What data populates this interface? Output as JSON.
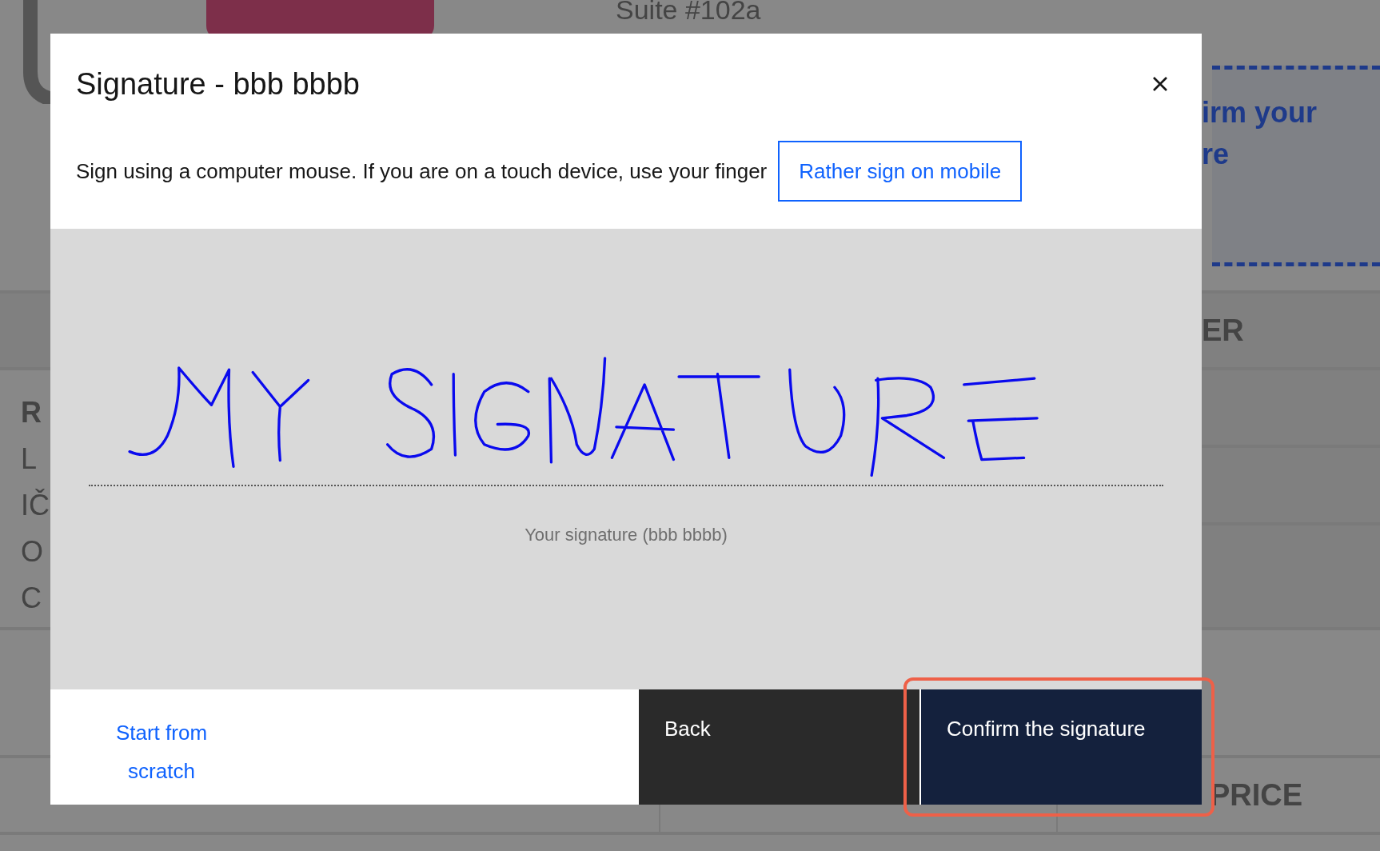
{
  "background": {
    "address": "Suite #102a",
    "notice": [
      "irm your",
      "re"
    ],
    "column_header": "ER",
    "party_lines": [
      {
        "text": "R",
        "bold": true
      },
      {
        "text": "L",
        "bold": false
      },
      {
        "text": "IČ",
        "bold": false
      },
      {
        "text": "O",
        "bold": false
      },
      {
        "text": "C",
        "bold": false
      }
    ],
    "table_header": "PRICE"
  },
  "dialog": {
    "title": "Signature - bbb bbbb",
    "instruction": "Sign using a computer mouse. If you are on a touch device, use your finger",
    "mobile_button": "Rather sign on mobile",
    "caption": "Your signature (bbb bbbb)",
    "footer": {
      "restart_link": "Start from scratch",
      "back_button": "Back",
      "confirm_button": "Confirm the signature",
      "confirm_highlighted": true
    }
  }
}
